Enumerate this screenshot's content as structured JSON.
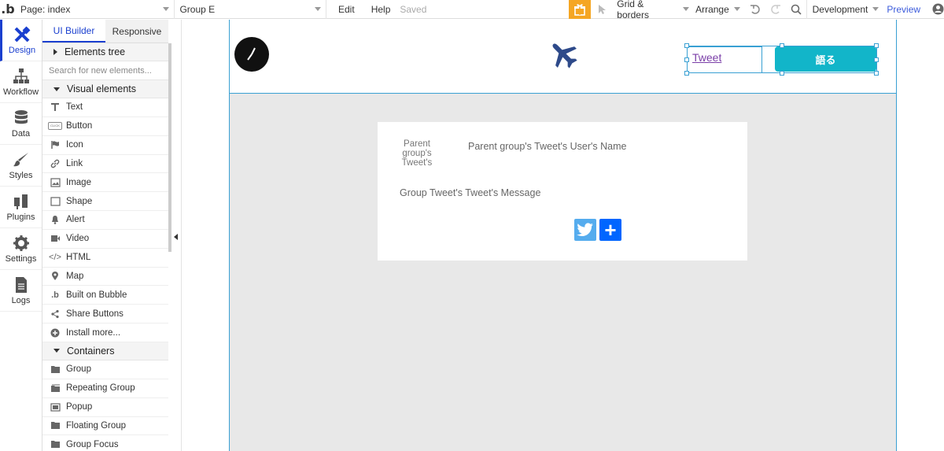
{
  "topbar": {
    "logo": ".b",
    "page_select": "Page: index",
    "element_select": "Group E",
    "menu_edit": "Edit",
    "menu_help": "Help",
    "save_status": "Saved",
    "grid_borders": "Grid & borders",
    "arrange": "Arrange",
    "environment": "Development",
    "preview": "Preview"
  },
  "iconbar": {
    "items": [
      {
        "label": "Design"
      },
      {
        "label": "Workflow"
      },
      {
        "label": "Data"
      },
      {
        "label": "Styles"
      },
      {
        "label": "Plugins"
      },
      {
        "label": "Settings"
      },
      {
        "label": "Logs"
      }
    ]
  },
  "panel": {
    "tabs": {
      "ui_builder": "UI Builder",
      "responsive": "Responsive"
    },
    "elements_tree": "Elements tree",
    "search_placeholder": "Search for new elements...",
    "visual_elements": "Visual elements",
    "visual_items": [
      {
        "label": "Text"
      },
      {
        "label": "Button",
        "icon_text": "CLICK"
      },
      {
        "label": "Icon"
      },
      {
        "label": "Link"
      },
      {
        "label": "Image"
      },
      {
        "label": "Shape"
      },
      {
        "label": "Alert"
      },
      {
        "label": "Video"
      },
      {
        "label": "HTML",
        "icon_text": "</>"
      },
      {
        "label": "Map"
      },
      {
        "label": "Built on Bubble",
        "icon_text": ".b"
      },
      {
        "label": "Share Buttons"
      },
      {
        "label": "Install more..."
      }
    ],
    "containers": "Containers",
    "container_items": [
      {
        "label": "Group"
      },
      {
        "label": "Repeating Group"
      },
      {
        "label": "Popup"
      },
      {
        "label": "Floating Group"
      },
      {
        "label": "Group Focus"
      }
    ]
  },
  "canvas": {
    "header": {
      "tweet_link": "Tweet",
      "speak_button": "語る"
    },
    "card": {
      "image_alt": "Parent group's Tweet's",
      "username": "Parent group's Tweet's User's Name",
      "message": "Group Tweet's Tweet's Message"
    }
  },
  "colors": {
    "accent": "#1a3fcf",
    "selection": "#39a0d3",
    "speak_button": "#12b5c9",
    "twitter": "#55acee",
    "share_plus": "#0166ff",
    "gift": "#f5a623",
    "plane": "#2e4a8a"
  }
}
